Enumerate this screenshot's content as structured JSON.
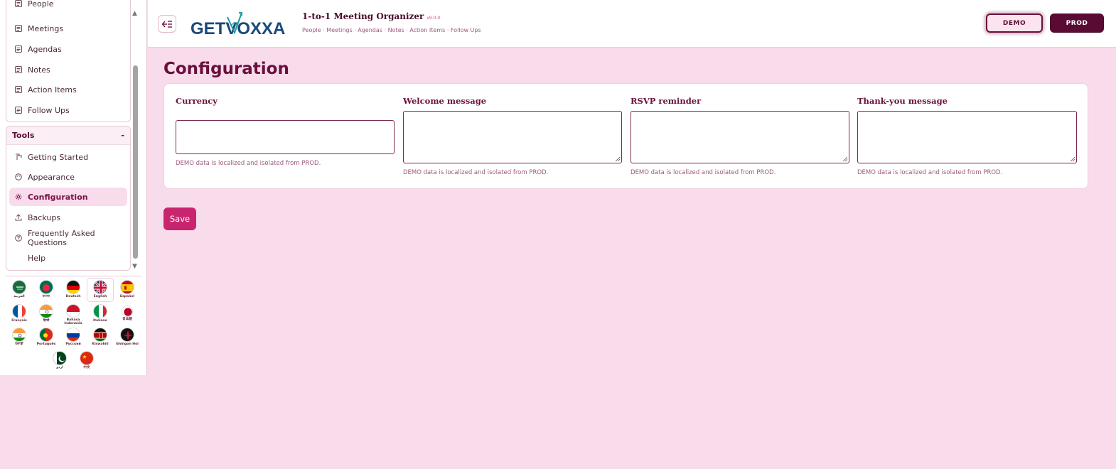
{
  "sidebar": {
    "top_items": [
      {
        "label": "People"
      },
      {
        "label": "Meetings"
      },
      {
        "label": "Agendas"
      },
      {
        "label": "Notes"
      },
      {
        "label": "Action Items"
      },
      {
        "label": "Follow Ups"
      }
    ],
    "tools": {
      "header": "Tools",
      "collapse_symbol": "-",
      "items": [
        {
          "label": "Getting Started",
          "icon": "getting-started-icon"
        },
        {
          "label": "Appearance",
          "icon": "palette-icon"
        },
        {
          "label": "Configuration",
          "icon": "gear-icon",
          "active": true
        },
        {
          "label": "Backups",
          "icon": "upload-icon"
        },
        {
          "label": "Frequently Asked Questions",
          "icon": "question-icon"
        },
        {
          "label": "Help",
          "icon": ""
        }
      ]
    },
    "languages": [
      {
        "label": "العربية"
      },
      {
        "label": "বাংলা"
      },
      {
        "label": "Deutsch"
      },
      {
        "label": "English",
        "selected": true
      },
      {
        "label": "Español"
      },
      {
        "label": "Français"
      },
      {
        "label": "हिन्दी"
      },
      {
        "label": "Bahasa Indonesia"
      },
      {
        "label": "Italiano"
      },
      {
        "label": "日本語"
      },
      {
        "label": "ਪੰਜਾਬੀ"
      },
      {
        "label": "Português"
      },
      {
        "label": "Русский"
      },
      {
        "label": "Kiswahili"
      },
      {
        "label": "Ghingon Hol"
      },
      {
        "label": "اردو"
      },
      {
        "label": "中文"
      }
    ]
  },
  "header": {
    "logo_text": "GETVOXXA",
    "app_title": "1-to-1 Meeting Organizer",
    "version": "v9.0.0",
    "subtitle": "People · Meetings · Agendas · Notes · Action Items · Follow Ups",
    "demo_label": "DEMO",
    "prod_label": "PROD"
  },
  "main": {
    "page_title": "Configuration",
    "fields": [
      {
        "label": "Currency",
        "value": "",
        "hint": "DEMO data is localized and isolated from PROD.",
        "type": "input"
      },
      {
        "label": "Welcome message",
        "value": "",
        "hint": "DEMO data is localized and isolated from PROD.",
        "type": "textarea"
      },
      {
        "label": "RSVP reminder",
        "value": "",
        "hint": "DEMO data is localized and isolated from PROD.",
        "type": "textarea"
      },
      {
        "label": "Thank-you message",
        "value": "",
        "hint": "DEMO data is localized and isolated from PROD.",
        "type": "textarea"
      }
    ],
    "save_label": "Save"
  },
  "colors": {
    "background": "#f8dcec",
    "primary": "#6a0f3c",
    "accent": "#c9256f",
    "prod": "#5a0b33"
  }
}
